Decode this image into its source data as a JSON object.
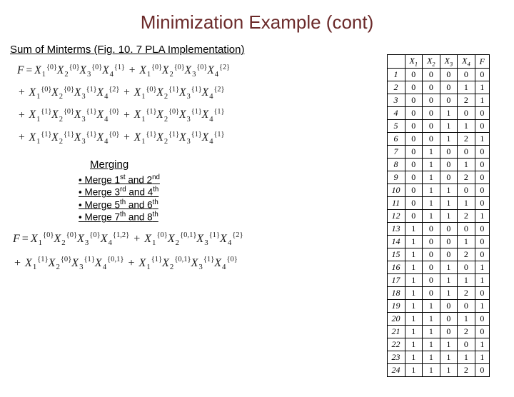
{
  "title": "Minimization Example (cont)",
  "subtitle": "Sum of Minterms (Fig. 10. 7 PLA Implementation)",
  "eq_top": {
    "rows": [
      [
        {
          "lead": "F ="
        },
        [
          [
            "1",
            "{0}"
          ],
          [
            "2",
            "{0}"
          ],
          [
            "3",
            "{0}"
          ],
          [
            "4",
            "{1}"
          ]
        ],
        "+",
        [
          [
            "1",
            "{0}"
          ],
          [
            "2",
            "{0}"
          ],
          [
            "3",
            "{0}"
          ],
          [
            "4",
            "{2}"
          ]
        ]
      ],
      [
        {
          "lead": "+"
        },
        [
          [
            "1",
            "{0}"
          ],
          [
            "2",
            "{0}"
          ],
          [
            "3",
            "{1}"
          ],
          [
            "4",
            "{2}"
          ]
        ],
        "+",
        [
          [
            "1",
            "{0}"
          ],
          [
            "2",
            "{1}"
          ],
          [
            "3",
            "{1}"
          ],
          [
            "4",
            "{2}"
          ]
        ]
      ],
      [
        {
          "lead": "+"
        },
        [
          [
            "1",
            "{1}"
          ],
          [
            "2",
            "{0}"
          ],
          [
            "3",
            "{1}"
          ],
          [
            "4",
            "{0}"
          ]
        ],
        "+",
        [
          [
            "1",
            "{1}"
          ],
          [
            "2",
            "{0}"
          ],
          [
            "3",
            "{1}"
          ],
          [
            "4",
            "{1}"
          ]
        ]
      ],
      [
        {
          "lead": "+"
        },
        [
          [
            "1",
            "{1}"
          ],
          [
            "2",
            "{1}"
          ],
          [
            "3",
            "{1}"
          ],
          [
            "4",
            "{0}"
          ]
        ],
        "+",
        [
          [
            "1",
            "{1}"
          ],
          [
            "2",
            "{1}"
          ],
          [
            "3",
            "{1}"
          ],
          [
            "4",
            "{1}"
          ]
        ]
      ]
    ]
  },
  "merging_head": "Merging",
  "merges": [
    {
      "b": "• ",
      "t1": "Merge 1",
      "o1": "st",
      "mid": " and 2",
      "o2": "nd"
    },
    {
      "b": "• ",
      "t1": "Merge 3",
      "o1": "rd",
      "mid": " and 4",
      "o2": "th"
    },
    {
      "b": "• ",
      "t1": "Merge 5",
      "o1": "th",
      "mid": " and 6",
      "o2": "th"
    },
    {
      "b": "• ",
      "t1": "Merge 7",
      "o1": "th",
      "mid": " and 8",
      "o2": "th"
    }
  ],
  "eq_bottom": {
    "rows": [
      [
        {
          "lead": "F ="
        },
        [
          [
            "1",
            "{0}"
          ],
          [
            "2",
            "{0}"
          ],
          [
            "3",
            "{0}"
          ],
          [
            "4",
            "{1,2}"
          ]
        ],
        "+",
        [
          [
            "1",
            "{0}"
          ],
          [
            "2",
            "{0,1}"
          ],
          [
            "3",
            "{1}"
          ],
          [
            "4",
            "{2}"
          ]
        ]
      ],
      [
        {
          "lead": "+"
        },
        [
          [
            "1",
            "{1}"
          ],
          [
            "2",
            "{0}"
          ],
          [
            "3",
            "{1}"
          ],
          [
            "4",
            "{0,1}"
          ]
        ],
        "+",
        [
          [
            "1",
            "{1}"
          ],
          [
            "2",
            "{0,1}"
          ],
          [
            "3",
            "{1}"
          ],
          [
            "4",
            "{0}"
          ]
        ]
      ]
    ]
  },
  "table": {
    "head": [
      "",
      "X1",
      "X2",
      "X3",
      "X4",
      "F"
    ],
    "groups": [
      [
        [
          "1",
          "0",
          "0",
          "0",
          "0",
          "0"
        ],
        [
          "2",
          "0",
          "0",
          "0",
          "1",
          "1"
        ],
        [
          "3",
          "0",
          "0",
          "0",
          "2",
          "1"
        ]
      ],
      [
        [
          "4",
          "0",
          "0",
          "1",
          "0",
          "0"
        ],
        [
          "5",
          "0",
          "0",
          "1",
          "1",
          "0"
        ],
        [
          "6",
          "0",
          "0",
          "1",
          "2",
          "1"
        ]
      ],
      [
        [
          "7",
          "0",
          "1",
          "0",
          "0",
          "0"
        ],
        [
          "8",
          "0",
          "1",
          "0",
          "1",
          "0"
        ],
        [
          "9",
          "0",
          "1",
          "0",
          "2",
          "0"
        ]
      ],
      [
        [
          "10",
          "0",
          "1",
          "1",
          "0",
          "0"
        ],
        [
          "11",
          "0",
          "1",
          "1",
          "1",
          "0"
        ],
        [
          "12",
          "0",
          "1",
          "1",
          "2",
          "1"
        ]
      ],
      [
        [
          "13",
          "1",
          "0",
          "0",
          "0",
          "0"
        ],
        [
          "14",
          "1",
          "0",
          "0",
          "1",
          "0"
        ],
        [
          "15",
          "1",
          "0",
          "0",
          "2",
          "0"
        ]
      ],
      [
        [
          "16",
          "1",
          "0",
          "1",
          "0",
          "1"
        ],
        [
          "17",
          "1",
          "0",
          "1",
          "1",
          "1"
        ],
        [
          "18",
          "1",
          "0",
          "1",
          "2",
          "0"
        ]
      ],
      [
        [
          "19",
          "1",
          "1",
          "0",
          "0",
          "1"
        ],
        [
          "20",
          "1",
          "1",
          "0",
          "1",
          "0"
        ],
        [
          "21",
          "1",
          "1",
          "0",
          "2",
          "0"
        ]
      ],
      [
        [
          "22",
          "1",
          "1",
          "1",
          "0",
          "1"
        ],
        [
          "23",
          "1",
          "1",
          "1",
          "1",
          "1"
        ],
        [
          "24",
          "1",
          "1",
          "1",
          "2",
          "0"
        ]
      ]
    ]
  }
}
